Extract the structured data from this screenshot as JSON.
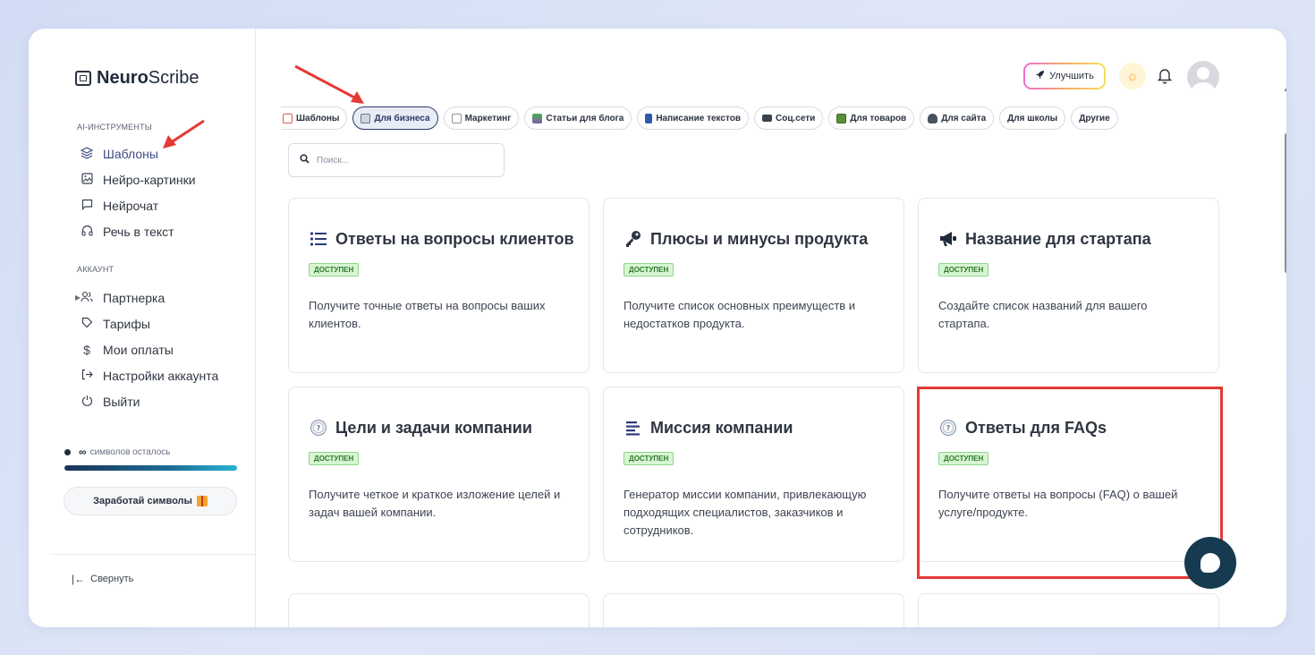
{
  "brand": {
    "logo_bold": "Neuro",
    "logo_rest": "Scribe"
  },
  "sidebar": {
    "section_ai": "AI-ИНСТРУМЕНТЫ",
    "ai_items": [
      {
        "label": "Шаблоны",
        "icon": "layers-icon"
      },
      {
        "label": "Нейро-картинки",
        "icon": "image-icon"
      },
      {
        "label": "Нейрочат",
        "icon": "chat-icon"
      },
      {
        "label": "Речь в текст",
        "icon": "headphones-icon"
      }
    ],
    "section_account": "АККАУНТ",
    "account_items": [
      {
        "label": "Партнерка",
        "icon": "users-icon"
      },
      {
        "label": "Тарифы",
        "icon": "tag-icon"
      },
      {
        "label": "Мои оплаты",
        "icon": "dollar-icon"
      },
      {
        "label": "Настройки аккаунта",
        "icon": "login-icon"
      },
      {
        "label": "Выйти",
        "icon": "power-icon"
      }
    ],
    "credits_symbol": "∞",
    "credits_text": "символов осталось",
    "earn_label": "Заработай символы",
    "collapse_label": "Свернуть"
  },
  "topbar": {
    "upgrade_label": "Улучшить"
  },
  "chips": [
    {
      "label": "Шаблоны",
      "color": "#e05a5a"
    },
    {
      "label": "Для бизнеса",
      "color": "#6c7a8c"
    },
    {
      "label": "Маркетинг",
      "color": "#8a8f99"
    },
    {
      "label": "Статьи для блога",
      "color": "#4caf50"
    },
    {
      "label": "Написание текстов",
      "color": "#2b5aa8"
    },
    {
      "label": "Соц.сети",
      "color": "#3a4150"
    },
    {
      "label": "Для товаров",
      "color": "#5a8f3a"
    },
    {
      "label": "Для сайта",
      "color": "#4a5260"
    },
    {
      "label": "Для школы",
      "color": ""
    },
    {
      "label": "Другие",
      "color": ""
    }
  ],
  "search": {
    "placeholder": "Поиск..."
  },
  "cards": [
    {
      "title": "Ответы на вопросы клиентов",
      "badge": "ДОСТУПЕН",
      "desc": "Получите точные ответы на вопросы ваших клиентов.",
      "icon": "list-icon"
    },
    {
      "title": "Плюсы и минусы продукта",
      "badge": "ДОСТУПЕН",
      "desc": "Получите список основных преимуществ и недостатков продукта.",
      "icon": "key-icon"
    },
    {
      "title": "Название для стартапа",
      "badge": "ДОСТУПЕН",
      "desc": "Создайте список названий для вашего стартапа.",
      "icon": "megaphone-icon"
    },
    {
      "title": "Цели и задачи компании",
      "badge": "ДОСТУПЕН",
      "desc": "Получите четкое и краткое изложение целей и задач вашей компании.",
      "icon": "question-icon"
    },
    {
      "title": "Миссия компании",
      "badge": "ДОСТУПЕН",
      "desc": "Генератор миссии компании, привлекающую подходящих специалистов, заказчиков и сотрудников.",
      "icon": "lines-icon"
    },
    {
      "title": "Ответы для FAQs",
      "badge": "ДОСТУПЕН",
      "desc": "Получите ответы на вопросы (FAQ) о вашей услуге/продукте.",
      "icon": "question-icon"
    }
  ],
  "colors": {
    "accent": "#2d3a66",
    "badge_bg": "#d7f5d3",
    "highlight": "#e53935",
    "fab": "#163a4f"
  }
}
